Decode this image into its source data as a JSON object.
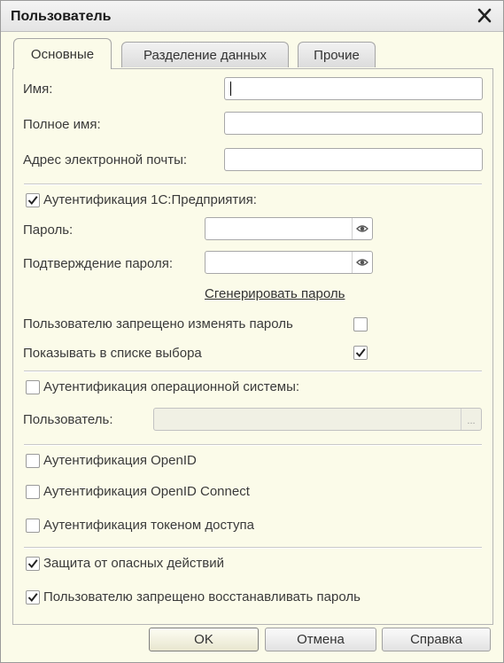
{
  "window": {
    "title": "Пользователь",
    "close_icon": "close-icon"
  },
  "tabs": [
    {
      "label": "Основные",
      "active": true
    },
    {
      "label": "Разделение данных",
      "active": false
    },
    {
      "label": "Прочие",
      "active": false
    }
  ],
  "form": {
    "name_label": "Имя:",
    "name_value": "",
    "full_name_label": "Полное имя:",
    "full_name_value": "",
    "email_label": "Адрес электронной почты:",
    "email_value": "",
    "auth_1c": {
      "label": "Аутентификация 1С:Предприятия:",
      "checked": true
    },
    "password_label": "Пароль:",
    "password_value": "",
    "password_confirm_label": "Подтверждение пароля:",
    "password_confirm_value": "",
    "generate_password_link": "Сгенерировать пароль",
    "cannot_change_password": {
      "label": "Пользователю запрещено изменять пароль",
      "checked": false
    },
    "show_in_list": {
      "label": "Показывать в списке выбора",
      "checked": true
    },
    "auth_os": {
      "label": "Аутентификация операционной системы:",
      "checked": false
    },
    "os_user_label": "Пользователь:",
    "os_user_value": "",
    "os_user_select_button": "...",
    "auth_openid": {
      "label": "Аутентификация OpenID",
      "checked": false
    },
    "auth_openid_connect": {
      "label": "Аутентификация OpenID Connect",
      "checked": false
    },
    "auth_token": {
      "label": "Аутентификация токеном доступа",
      "checked": false
    },
    "unsafe_action_protection": {
      "label": "Защита от опасных действий",
      "checked": true
    },
    "cannot_recover_password": {
      "label": "Пользователю запрещено восстанавливать пароль",
      "checked": true
    }
  },
  "buttons": {
    "ok": "OK",
    "cancel": "Отмена",
    "help": "Справка"
  },
  "colors": {
    "dialog_background": "#fbfbe9",
    "check_mark": "#222222"
  }
}
